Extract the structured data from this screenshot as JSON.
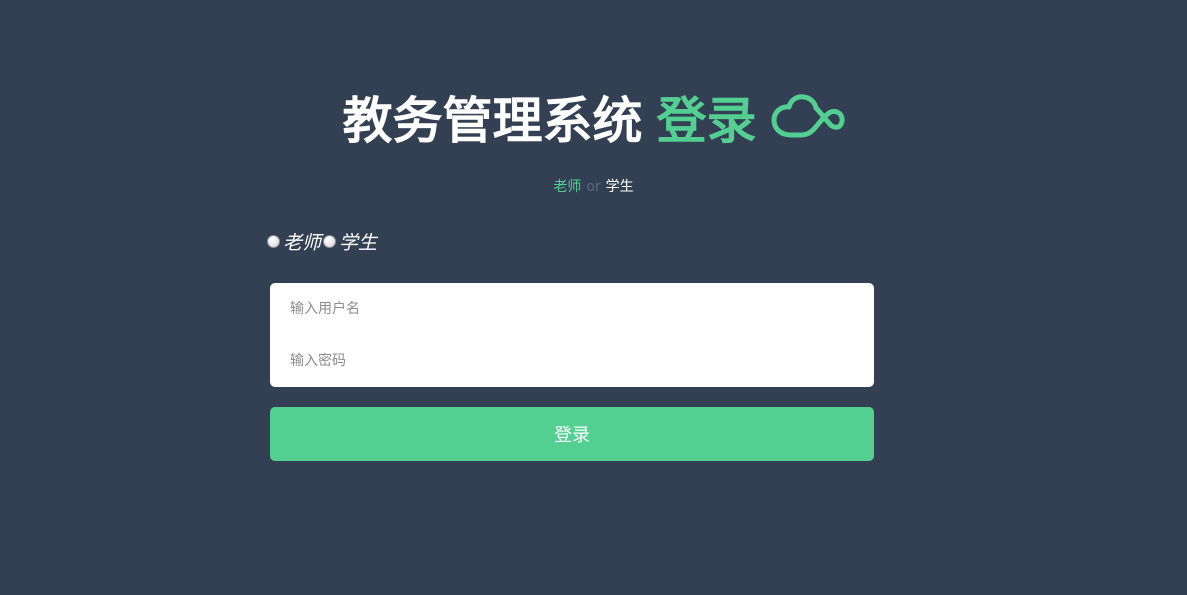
{
  "header": {
    "title_main": "教务管理系统",
    "title_accent": "登录",
    "accent_color": "#52cf91",
    "icon": "cloud-icon"
  },
  "subtitle": {
    "teacher": "老师",
    "or": "or",
    "student": "学生"
  },
  "role_selector": {
    "options": [
      {
        "label": "老师",
        "selected": false
      },
      {
        "label": "学生",
        "selected": false
      }
    ]
  },
  "form": {
    "username_placeholder": "输入用户名",
    "username_value": "",
    "password_placeholder": "输入密码",
    "password_value": ""
  },
  "login_button": {
    "label": "登录"
  },
  "theme": {
    "background": "#334054",
    "accent": "#52cf91"
  }
}
